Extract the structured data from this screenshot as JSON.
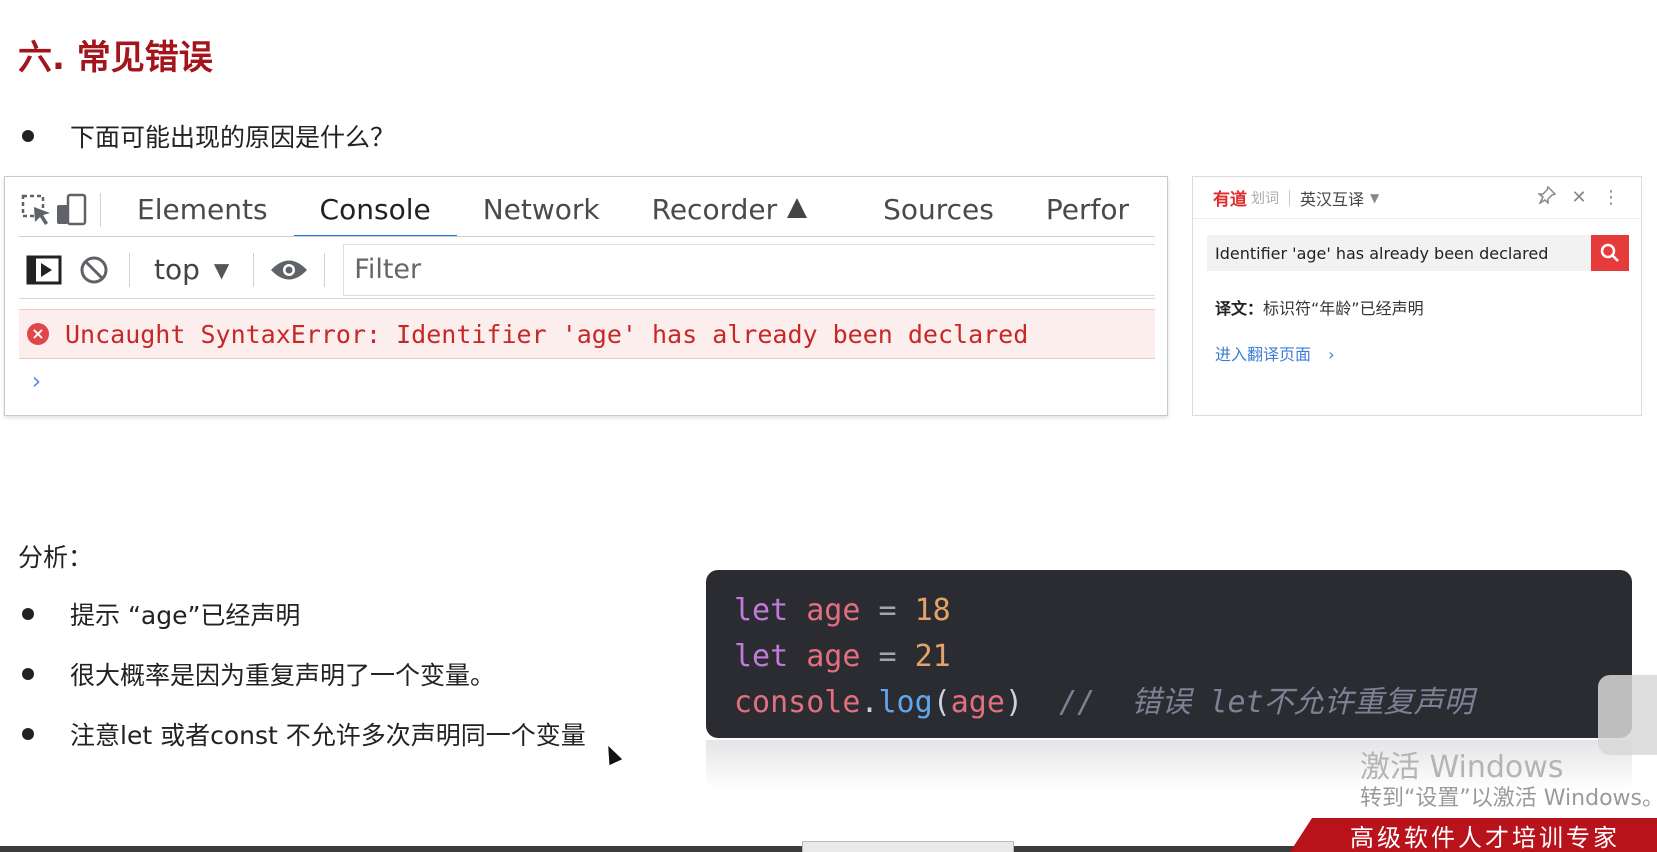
{
  "slide": {
    "title": "六. 常见错误",
    "question": "下面可能出现的原因是什么？",
    "analysis_label": "分析：",
    "analysis_points": [
      "提示 “age”已经声明",
      "很大概率是因为重复声明了一个变量。",
      "注意let 或者const  不允许多次声明同一个变量"
    ]
  },
  "devtools": {
    "tabs": [
      "Elements",
      "Console",
      "Network",
      "Recorder",
      "Sources",
      "Perfor"
    ],
    "active_tab": "Console",
    "context_select": "top",
    "filter_placeholder": "Filter",
    "error_message": "Uncaught SyntaxError: Identifier 'age' has already been declared",
    "prompt_symbol": "›",
    "icons": [
      "inspect-icon",
      "device-toggle-icon",
      "sidebar-toggle-icon",
      "clear-console-icon",
      "live-expression-eye-icon",
      "error-icon"
    ]
  },
  "youdao": {
    "logo": "有道",
    "logo_sub": "划词",
    "mode": "英汉互译",
    "query": "Identifier 'age' has already been declared",
    "translation_label": "译文：",
    "translation": "标识符“年龄”已经声明",
    "link": "进入翻译页面",
    "accent_color": "#e63b3b"
  },
  "code": {
    "line1": {
      "kw": "let",
      "var": "age",
      "op": "=",
      "num": "18"
    },
    "line2": {
      "kw": "let",
      "var": "age",
      "op": "=",
      "num": "21"
    },
    "line3": {
      "obj": "console",
      "dot": ".",
      "fn": "log",
      "open": "(",
      "arg": "age",
      "close": ")",
      "comment": "//  错误 let不允许重复声明"
    }
  },
  "watermark": {
    "line1": "激活 Windows",
    "line2": "转到“设置”以激活 Windows。"
  },
  "banner": {
    "text": "高级软件人才培训专家"
  }
}
